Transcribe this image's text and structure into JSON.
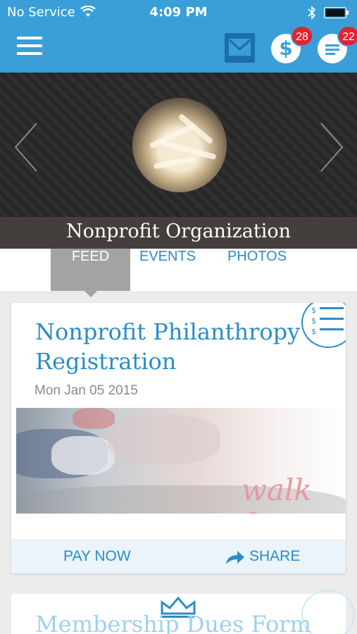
{
  "status_bar": {
    "carrier": "No Service",
    "time": "4:09 PM"
  },
  "nav": {
    "dollar_badge": "28",
    "chat_badge": "22",
    "dollar_glyph": "$"
  },
  "hero": {
    "org_name": "Nonprofit Organization"
  },
  "tabs": [
    {
      "label": "FEED",
      "active": true
    },
    {
      "label": "EVENTS",
      "active": false
    },
    {
      "label": "PHOTOS",
      "active": false
    }
  ],
  "card": {
    "title": "Nonprofit Philanthropy Registration",
    "date": "Mon Jan 05 2015",
    "image_caption": "walk fo",
    "pay_label": "PAY NOW",
    "share_label": "SHARE"
  },
  "card2": {
    "title": "Membership Dues Form"
  },
  "colors": {
    "accent": "#3a9fd8",
    "link": "#2a8cc9",
    "badge": "#e2222f"
  },
  "icons": [
    "menu-icon",
    "mail-icon",
    "dollar-icon",
    "chat-icon",
    "chevron-left-icon",
    "chevron-right-icon",
    "list-dollar-icon",
    "share-arrow-icon",
    "crown-icon"
  ]
}
